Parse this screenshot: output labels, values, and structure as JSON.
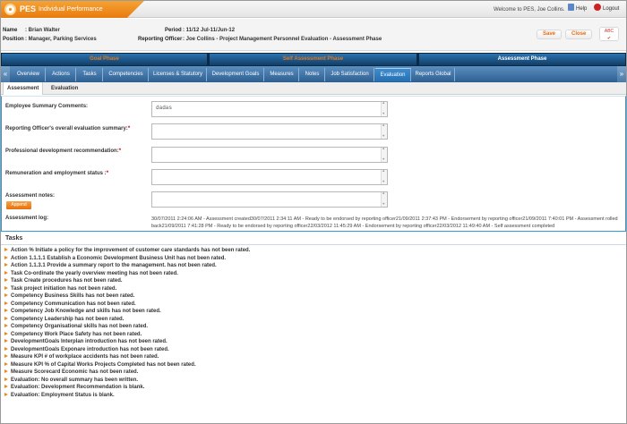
{
  "app": {
    "logo_text": "PES",
    "subtitle": "Individual Performance"
  },
  "topbar": {
    "welcome": "Welcome to PES, Joe Collins.",
    "help": "Help",
    "logout": "Logout"
  },
  "employee": {
    "name_label": "Name",
    "name": ": Brian Walter",
    "position_label": "Position",
    "position": ": Manager, Parking Services",
    "period_label": "Period",
    "period": ": 11/12 Jul-11/Jun-12",
    "officer_label": "Reporting Officer",
    "officer": ": Joe Collins - Project Management Personnel Evaluation - Assessment Phase"
  },
  "actions": {
    "save": "Save",
    "close": "Close",
    "spell": "ABC"
  },
  "phases": [
    {
      "label": "Goal Phase"
    },
    {
      "label": "Self Assessment Phase"
    },
    {
      "label": "Assessment Phase"
    }
  ],
  "tabs": [
    {
      "label": "Overview"
    },
    {
      "label": "Actions"
    },
    {
      "label": "Tasks"
    },
    {
      "label": "Competencies"
    },
    {
      "label": "Licenses & Statutory"
    },
    {
      "label": "Development Goals"
    },
    {
      "label": "Measures"
    },
    {
      "label": "Notes"
    },
    {
      "label": "Job Satisfaction"
    },
    {
      "label": "Evaluation"
    },
    {
      "label": "Reports Global"
    }
  ],
  "subtabs": [
    {
      "label": "Assessment"
    },
    {
      "label": "Evaluation"
    }
  ],
  "form": {
    "employee_summary_label": "Employee Summary Comments:",
    "employee_summary_value": "dadas",
    "officer_summary_label": "Reporting Officer's overall evaluation summary:",
    "prof_dev_label": "Professional development recommendation:",
    "remuneration_label": "Remuneration and employment status :",
    "notes_label": "Assessment notes:",
    "append_label": "Append",
    "log_label": "Assessment log:",
    "log_text": "30/07/2011 2:24:06 AM - Assessment created30/07/2011 2:34:11 AM - Ready to be endorsed by reporting officer21/09/2011 2:37:43 PM - Endorsement by reporting officer21/09/2011 7:40:01 PM - Assessment rolled back21/09/2011 7:41:28 PM - Ready to be endorsed by reporting officer22/03/2012 11:45:29 AM - Endorsement by reporting officer22/03/2012 11:49:40 AM - Self assessment completed"
  },
  "tasks": {
    "title": "Tasks",
    "items": [
      "Action % Initiate a policy for the improvement of customer care standards has not been rated.",
      "Action 1.1.1.1 Establish a Economic Development Business Unit has not been rated.",
      "Action 1.1.3.1 Provide a summary report to the management. has not been rated.",
      "Task Co-ordinate the yearly overview meeting has not been rated.",
      "Task Create procedures has not been rated.",
      "Task project initiation has not been rated.",
      "Competency Business Skills has not been rated.",
      "Competency Communication has not been rated.",
      "Competency Job Knowledge and skills has not been rated.",
      "Competency Leadership has not been rated.",
      "Competency Organisational skills has not been rated.",
      "Competency Work Place Safety has not been rated.",
      "DevelopmentGoals Interplan introduction has not been rated.",
      "DevelopmentGoals Exponare introduction has not been rated.",
      "Measure KPI # of workplace accidents has not been rated.",
      "Measure KPI % of Capital Works Projects Completed has not been rated.",
      "Measure Scorecard Economic has not been rated.",
      "Evaluation: No overall summary has been written.",
      "Evaluation: Development Recommendation is blank.",
      "Evaluation: Employment Status is blank."
    ]
  }
}
